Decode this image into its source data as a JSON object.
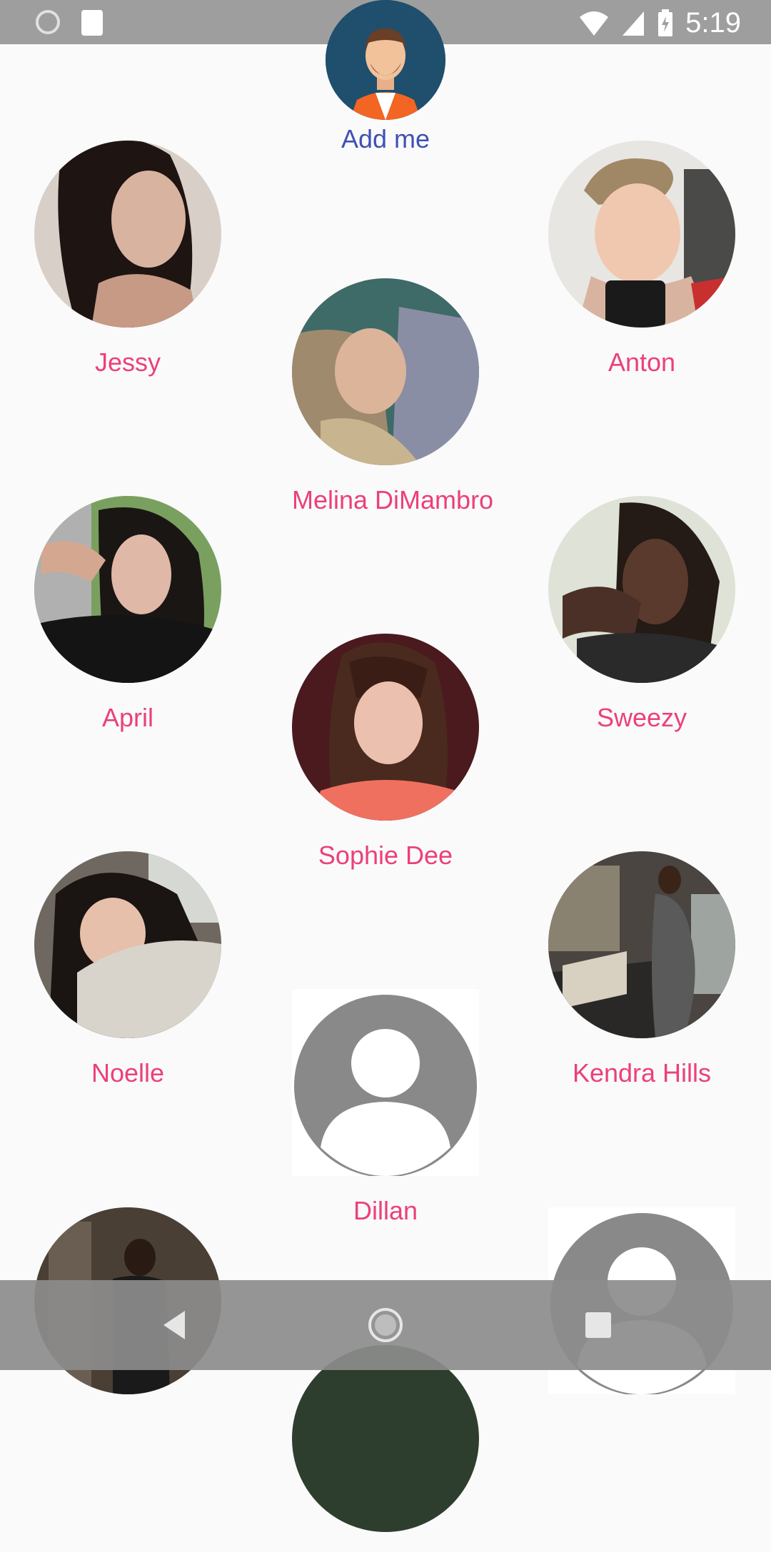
{
  "status_bar": {
    "time": "5:19",
    "left_icons": [
      "sync-icon",
      "sd-card-icon"
    ],
    "right_icons": [
      "wifi-icon",
      "cell-signal-icon",
      "battery-charging-icon"
    ]
  },
  "add_me": {
    "label": "Add me",
    "icon": "male-avatar-icon"
  },
  "contacts": [
    {
      "name": "Jessy",
      "photo": true,
      "color": "#3a2a28"
    },
    {
      "name": "Anton",
      "photo": true,
      "color": "#8a7060"
    },
    {
      "name": "Melina DiMambro",
      "photo": true,
      "color": "#4e6e6a"
    },
    {
      "name": "April",
      "photo": true,
      "color": "#3b3533"
    },
    {
      "name": "Sweezy",
      "photo": true,
      "color": "#3d2e2a"
    },
    {
      "name": "Sophie Dee",
      "photo": true,
      "color": "#5a1e22"
    },
    {
      "name": "Noelle",
      "photo": true,
      "color": "#4a4540"
    },
    {
      "name": "Kendra Hills",
      "photo": true,
      "color": "#4a4743"
    },
    {
      "name": "Dillan",
      "photo": false,
      "color": "#888888"
    },
    {
      "name": "",
      "photo": true,
      "color": "#4a3f35"
    },
    {
      "name": "",
      "photo": false,
      "color": "#888888"
    },
    {
      "name": "",
      "photo": true,
      "color": "#2e3e2e"
    }
  ],
  "nav_bar": {
    "back": "back-icon",
    "home": "home-icon",
    "recents": "recents-icon"
  },
  "colors": {
    "name_text": "#ec407a",
    "add_me_text": "#3f51b5",
    "background": "#fafafa"
  }
}
